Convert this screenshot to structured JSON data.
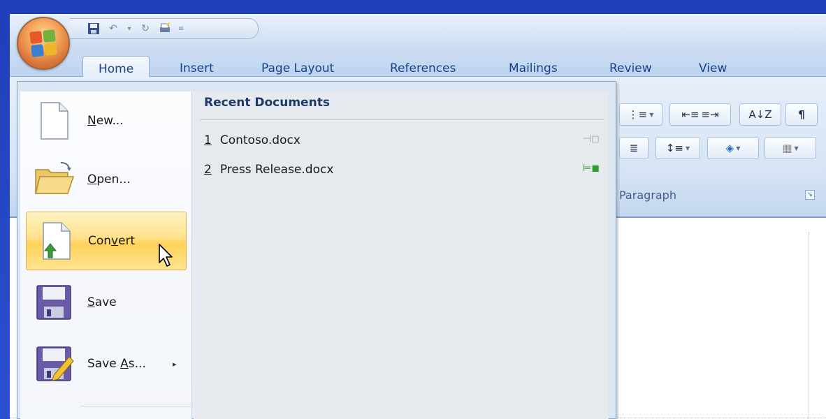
{
  "qat": {
    "icons": [
      "save-icon",
      "undo-icon",
      "dropdown-icon",
      "redo-icon",
      "quick-print-icon",
      "customize-icon"
    ]
  },
  "tabs": [
    {
      "label": "Home",
      "active": true
    },
    {
      "label": "Insert",
      "active": false
    },
    {
      "label": "Page Layout",
      "active": false
    },
    {
      "label": "References",
      "active": false
    },
    {
      "label": "Mailings",
      "active": false
    },
    {
      "label": "Review",
      "active": false
    },
    {
      "label": "View",
      "active": false
    }
  ],
  "ribbon": {
    "group_label": "Paragraph",
    "row1": [
      {
        "name": "multilevel-list-button",
        "glyph": "⋮≡",
        "dropdown": true
      },
      {
        "name": "decrease-indent-button",
        "glyph": "⇤≡"
      },
      {
        "name": "increase-indent-button",
        "glyph": "≡⇥"
      },
      {
        "name": "sort-button",
        "glyph": "A↓Z"
      },
      {
        "name": "show-hide-button",
        "glyph": "¶"
      }
    ],
    "row2": [
      {
        "name": "justify-button",
        "glyph": "≣"
      },
      {
        "name": "line-spacing-button",
        "glyph": "↕≡",
        "dropdown": true
      },
      {
        "name": "shading-button",
        "glyph": "◈",
        "dropdown": true
      },
      {
        "name": "borders-button",
        "glyph": "▦",
        "dropdown": true
      }
    ]
  },
  "menu": {
    "items": [
      {
        "key": "new",
        "pre": "",
        "u": "N",
        "post": "ew...",
        "icon": "new-document-icon"
      },
      {
        "key": "open",
        "pre": "",
        "u": "O",
        "post": "pen...",
        "icon": "open-folder-icon"
      },
      {
        "key": "convert",
        "pre": "Con",
        "u": "v",
        "post": "ert",
        "icon": "convert-icon",
        "highlighted": true
      },
      {
        "key": "save",
        "pre": "",
        "u": "S",
        "post": "ave",
        "icon": "save-disk-icon"
      },
      {
        "key": "saveas",
        "pre": "Save ",
        "u": "A",
        "post": "s...",
        "icon": "save-as-icon",
        "submenu": "▸"
      }
    ],
    "recent_title": "Recent Documents",
    "recent": [
      {
        "num": "1",
        "name": "Contoso.docx",
        "pinned": false
      },
      {
        "num": "2",
        "name": "Press Release.docx",
        "pinned": true
      }
    ]
  },
  "colors": {
    "highlight": "#ffd35a",
    "tab_text": "#15428b",
    "pin_green": "#2e9c2e",
    "pin_gray": "#9aa3ad"
  }
}
